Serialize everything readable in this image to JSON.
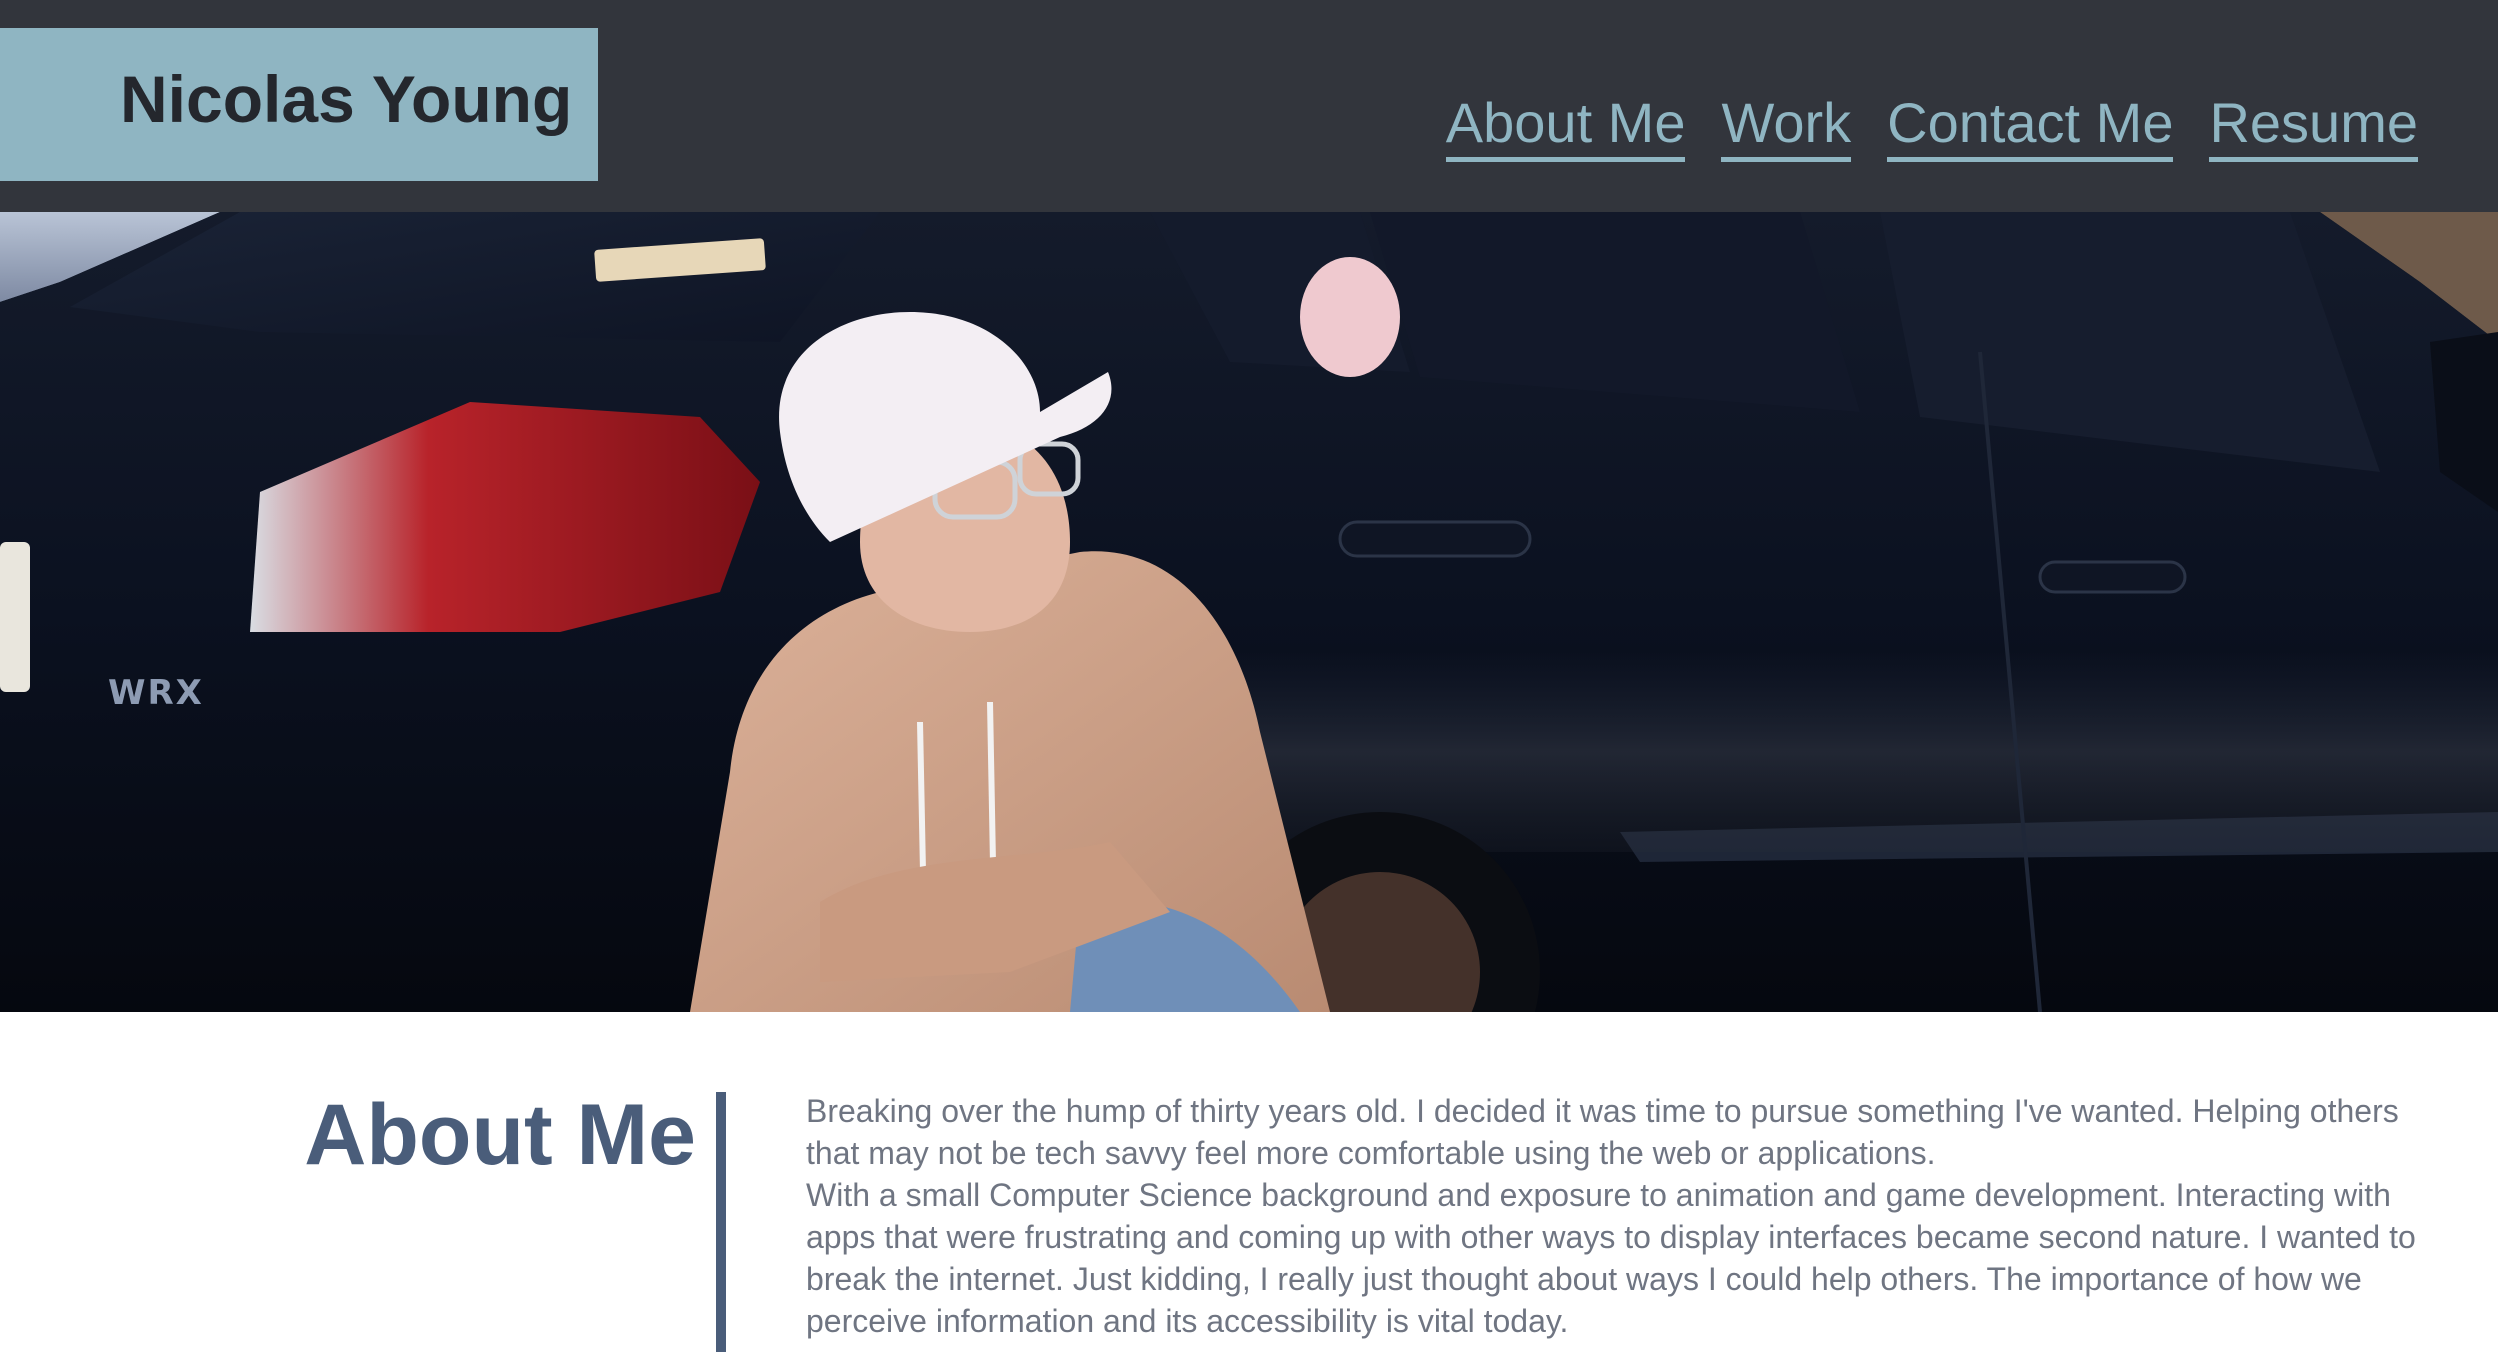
{
  "header": {
    "brand": "Nicolas Young",
    "nav": [
      {
        "label": "About Me"
      },
      {
        "label": "Work"
      },
      {
        "label": "Contact Me"
      },
      {
        "label": "Resume"
      }
    ]
  },
  "hero": {
    "car_badge": "WRX"
  },
  "about": {
    "heading": "About Me",
    "paragraphs": [
      "Breaking over the hump of thirty years old. I decided it was time to pursue something I've wanted. Helping others that may not be tech savvy feel more comfortable using the web or applications.",
      "With a small Computer Science background and exposure to animation and game development. Interacting with apps that were frustrating and coming up with other ways to display interfaces became second nature. I wanted to break the internet. Just kidding, I really just thought about ways I could help others. The importance of how we perceive information and its accessibility is vital today."
    ]
  },
  "colors": {
    "header_bg": "#32353c",
    "accent": "#8fb5c2",
    "heading": "#4a5d7a",
    "body_text": "#6f7582"
  }
}
